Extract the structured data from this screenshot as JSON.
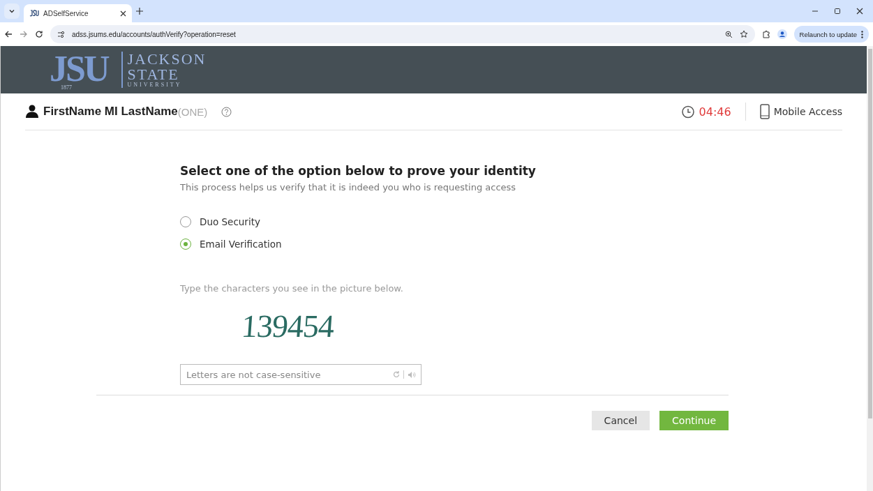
{
  "browser": {
    "tab_title": "ADSelfService",
    "url": "adss.jsums.edu/accounts/authVerify?operation=reset",
    "relaunch": "Relaunch to update"
  },
  "logo": {
    "monogram": "JSU",
    "year": "1877",
    "line1": "JACKSON",
    "line2": "STATE",
    "line3": "UNIVERSITY"
  },
  "user": {
    "name": "FirstName MI LastName",
    "domain": "(ONE)"
  },
  "timer": "04:46",
  "mobile_access": "Mobile Access",
  "heading": "Select one of the option below to prove your identity",
  "subheading": "This process helps us verify that it is indeed you who is requesting access",
  "options": [
    {
      "label": "Duo Security",
      "selected": false
    },
    {
      "label": "Email Verification",
      "selected": true
    }
  ],
  "captcha": {
    "instruction": "Type the characters you see in the picture below.",
    "image_text": "139454",
    "placeholder": "Letters are not case-sensitive"
  },
  "buttons": {
    "cancel": "Cancel",
    "continue": "Continue"
  }
}
